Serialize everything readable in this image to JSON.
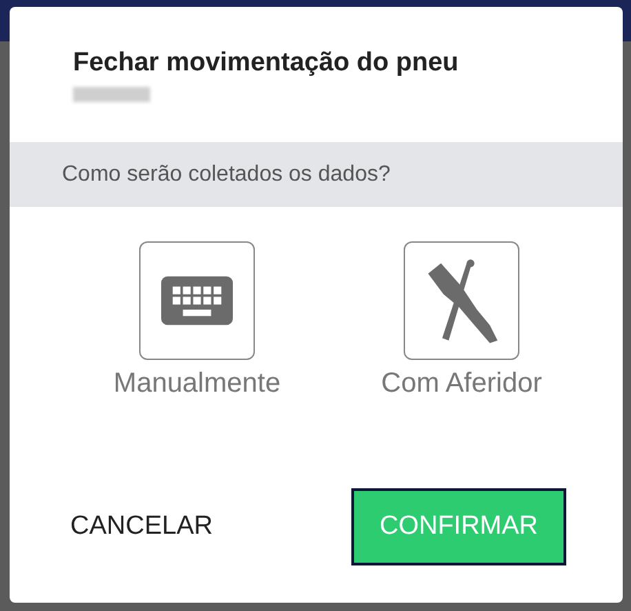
{
  "dialog": {
    "title": "Fechar movimentação do pneu",
    "subtitle_redacted": true,
    "prompt": "Como serão coletados os dados?",
    "options": [
      {
        "kind": "keyboard",
        "label": "Manualmente"
      },
      {
        "kind": "gauge",
        "label": "Com Aferidor"
      }
    ],
    "buttons": [
      {
        "kind": "text",
        "label": "CANCELAR"
      },
      {
        "kind": "primary",
        "label": "CONFIRMAR"
      }
    ]
  }
}
